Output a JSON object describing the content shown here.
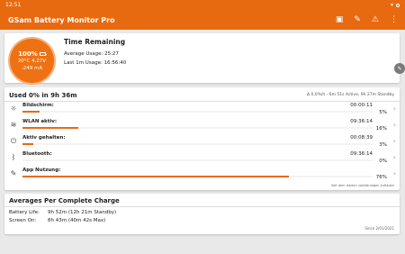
{
  "status": {
    "time": "12:51"
  },
  "app": {
    "title": "GSam Battery Monitor Pro"
  },
  "battery": {
    "percent": "100%",
    "temp": "20°C",
    "voltage": "4.27V",
    "current": "-249 mA"
  },
  "time_remaining": {
    "heading": "Time Remaining",
    "avg_label": "Average Usage:",
    "avg_value": "25:27",
    "last_label": "Last 1m Usage:",
    "last_value": "16:56:40"
  },
  "usage": {
    "title": "Used 0% in 9h 36m",
    "summary": "Δ 0,0%/h - 6m 51s Active, 9h 27m Standby",
    "items": [
      {
        "icon": "brightness-icon",
        "label": "Bildschirm:",
        "time": "00:00:11",
        "percent": "5%",
        "fill": 0.05
      },
      {
        "icon": "wifi-icon",
        "label": "WLAN aktiv:",
        "time": "09:36:14",
        "percent": "16%",
        "fill": 0.16
      },
      {
        "icon": "power-icon",
        "label": "Aktiv gehalten:",
        "time": "00:08:39",
        "percent": "3%",
        "fill": 0.03
      },
      {
        "icon": "bluetooth-icon",
        "label": "Bluetooth:",
        "time": "09:36:14",
        "percent": "0%",
        "fill": 0.0
      },
      {
        "icon": "app-icon",
        "label": "App Nutzung:",
        "time": "",
        "percent": "76%",
        "fill": 0.76
      }
    ],
    "footnote": "Seit dem letzten vollständigen Aufladen"
  },
  "averages": {
    "title": "Averages Per Complete Charge",
    "battery_label": "Battery Life:",
    "battery_value": "9h 52m (12h 21m Standby)",
    "screen_label": "Screen On:",
    "screen_value": "8h 43m (40m 42s Max)",
    "since": "Since 2/01/2021"
  },
  "colors": {
    "accent": "#e86a10"
  }
}
